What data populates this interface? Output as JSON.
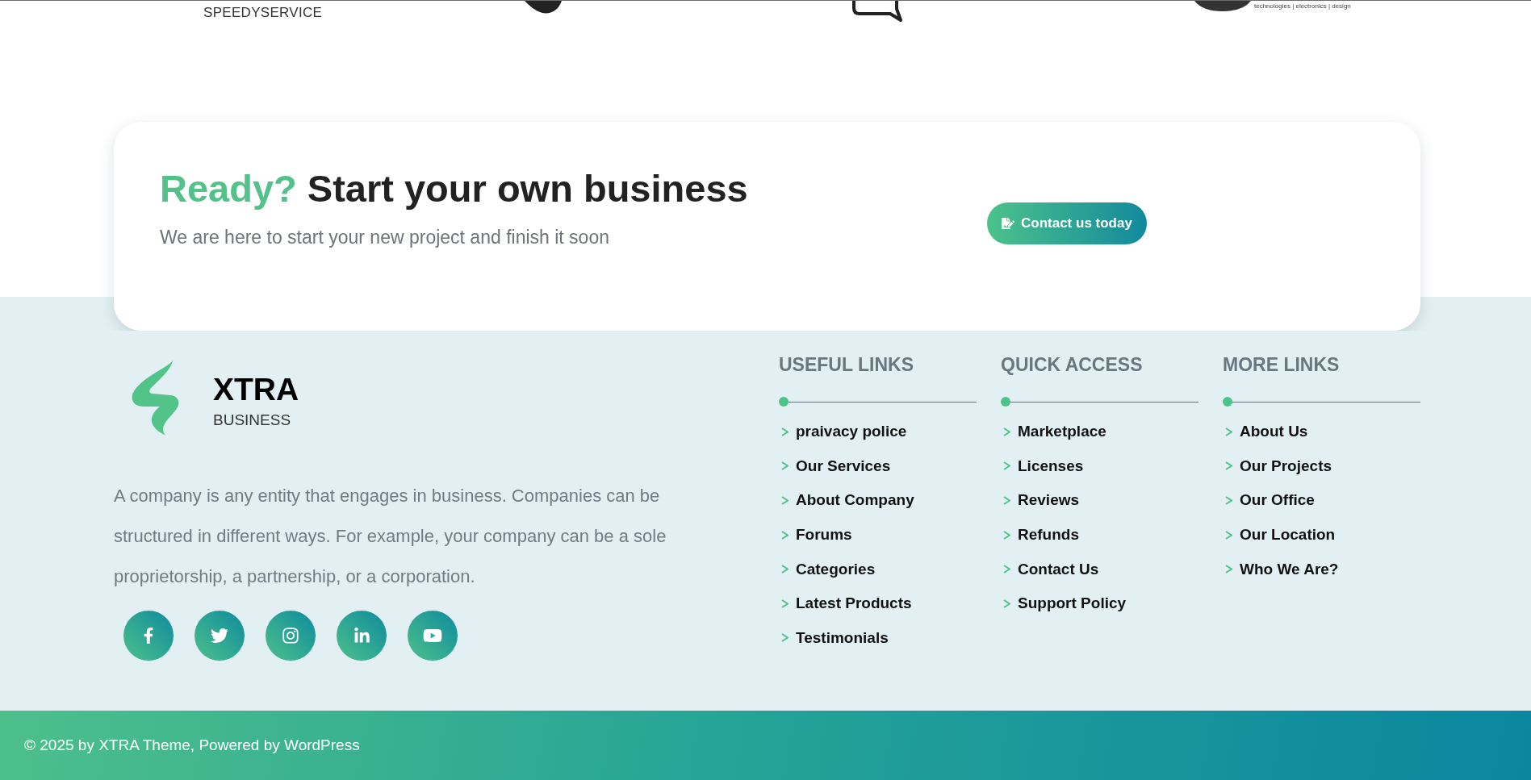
{
  "partner_logos": [
    {
      "kind": "wordmark",
      "caption": "SPEEDYSERVICE"
    },
    {
      "kind": "swoosh"
    },
    {
      "kind": "bubble"
    },
    {
      "kind": "oval",
      "caption": "technologies | electronics | design"
    }
  ],
  "cta": {
    "title_highlight": "Ready?",
    "title": "Start your own business",
    "subtitle": "We are here to start your new project and finish it soon",
    "button": "Contact us today"
  },
  "footer": {
    "brand": {
      "name": "XTRA",
      "tagline": "BUSINESS"
    },
    "about": "A company is any entity that engages in business. Companies can be structured in different ways. For example, your company can be a sole proprietorship, a partnership, or a corporation.",
    "social": [
      {
        "kind": "facebook"
      },
      {
        "kind": "twitter"
      },
      {
        "kind": "instagram"
      },
      {
        "kind": "linkedin"
      },
      {
        "kind": "youtube"
      }
    ],
    "link_columns": [
      {
        "heading": "USEFUL LINKS",
        "links": [
          "praivacy police",
          "Our Services",
          "About Company",
          "Forums",
          "Categories",
          "Latest Products",
          "Testimonials"
        ]
      },
      {
        "heading": "QUICK ACCESS",
        "links": [
          "Marketplace",
          "Licenses",
          "Reviews",
          "Refunds",
          "Contact Us",
          "Support Policy"
        ]
      },
      {
        "heading": "MORE LINKS",
        "links": [
          "About Us",
          "Our Projects",
          "Our Office",
          "Our Location",
          "Who We Are?"
        ]
      }
    ]
  },
  "copyright": "© 2025 by XTRA Theme, Powered by WordPress"
}
